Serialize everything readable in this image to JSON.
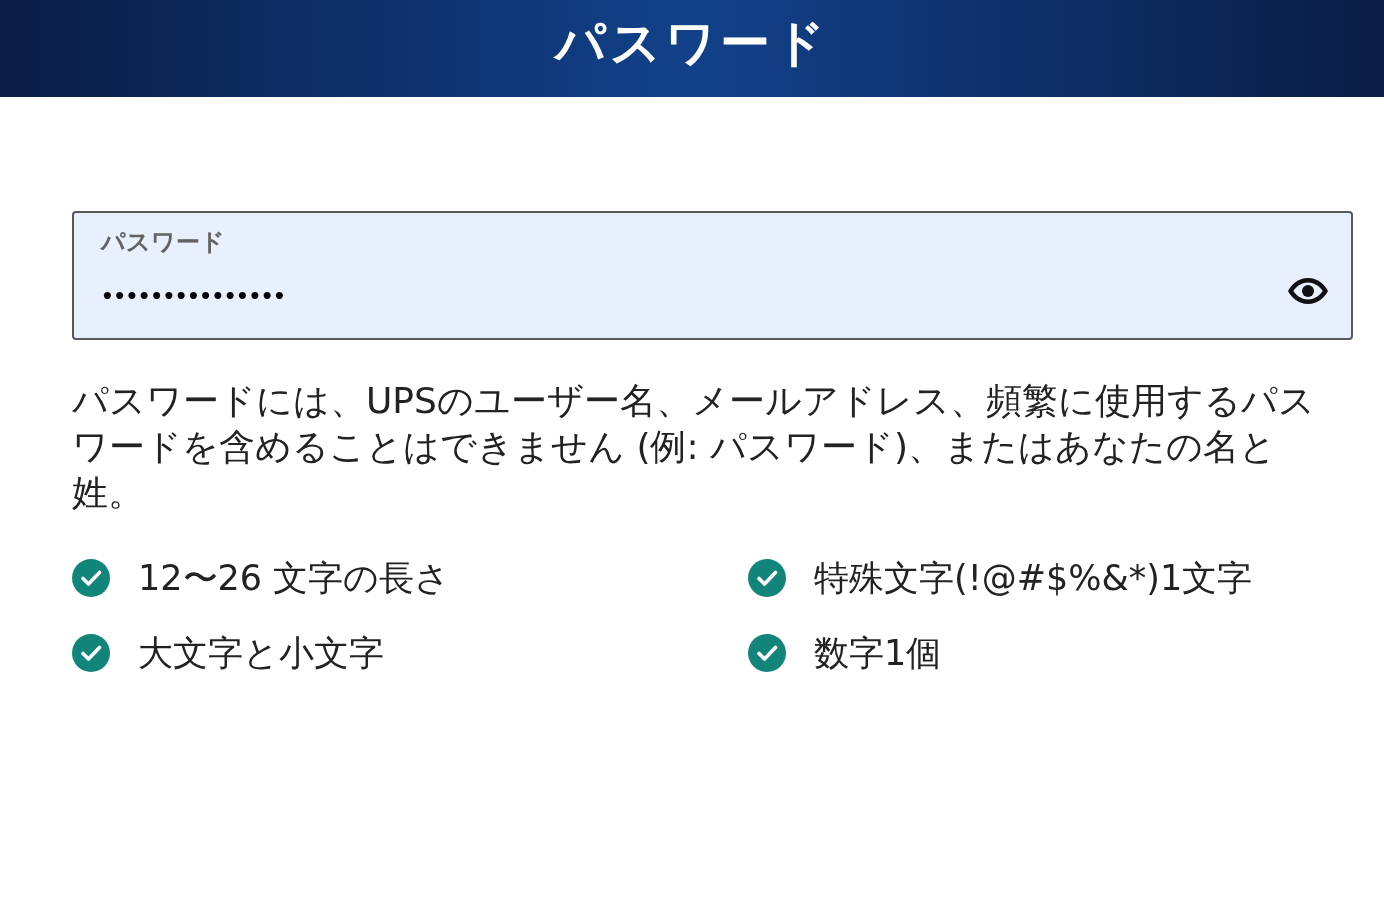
{
  "header": {
    "title": "パスワード"
  },
  "password_field": {
    "label": "パスワード",
    "value": "•••••••••••••••"
  },
  "hint": "パスワードには、UPSのユーザー名、メールアドレス、頻繁に使用するパスワードを含めることはできません (例: パスワード)、またはあなたの名と姓。",
  "requirements": [
    {
      "text": "12〜26 文字の長さ",
      "met": true
    },
    {
      "text": "特殊文字(!@#$%&*)1文字",
      "met": true
    },
    {
      "text": "大文字と小文字",
      "met": true
    },
    {
      "text": "数字1個",
      "met": true
    }
  ]
}
